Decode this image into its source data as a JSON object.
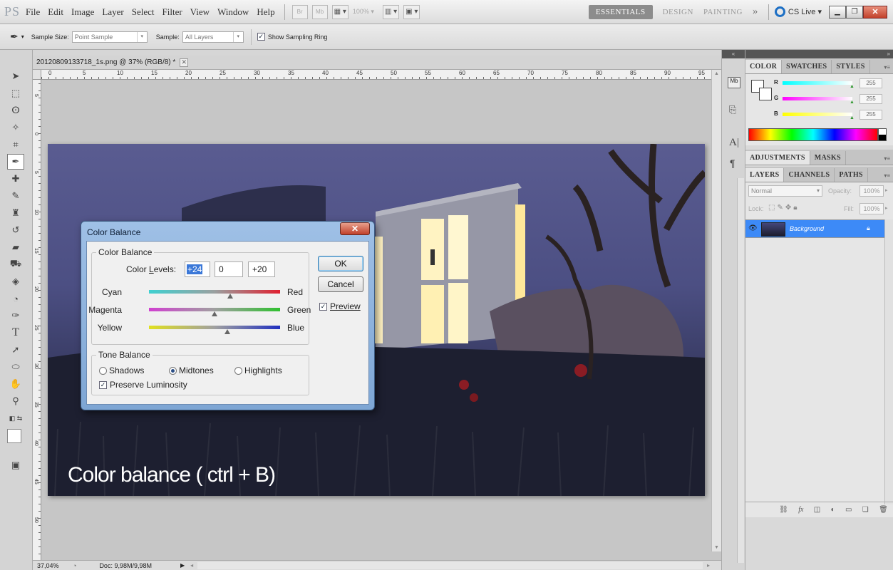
{
  "app": {
    "logo": "PS"
  },
  "menu": [
    "File",
    "Edit",
    "Image",
    "Layer",
    "Select",
    "Filter",
    "View",
    "Window",
    "Help"
  ],
  "topbar": {
    "br_label": "Br",
    "mb_label": "Mb",
    "zoom": "100%",
    "workspaces": [
      "ESSENTIALS",
      "DESIGN",
      "PAINTING"
    ],
    "more": "»",
    "cslive": "CS Live"
  },
  "options": {
    "sample_size_label": "Sample Size:",
    "sample_size_value": "Point Sample",
    "sample_label": "Sample:",
    "sample_value": "All Layers",
    "show_ring_label": "Show Sampling Ring"
  },
  "document": {
    "tab_title": "20120809133718_1s.png @ 37% (RGB/8) *",
    "ruler_top": [
      "0",
      "5",
      "10",
      "15",
      "20",
      "25",
      "30",
      "35",
      "40",
      "45",
      "50",
      "55",
      "60",
      "65",
      "70",
      "75",
      "80",
      "85",
      "90",
      "95"
    ],
    "ruler_left": [
      "5",
      "0",
      "5",
      "10",
      "15",
      "20",
      "25",
      "30",
      "35",
      "40",
      "45",
      "50"
    ],
    "caption": "Color balance ( ctrl + B)"
  },
  "status": {
    "zoom": "37,04%",
    "doc": "Doc: 9,98M/9,98M"
  },
  "color_panel": {
    "tabs": [
      "COLOR",
      "SWATCHES",
      "STYLES"
    ],
    "channels": [
      {
        "label": "R",
        "value": "255"
      },
      {
        "label": "G",
        "value": "255"
      },
      {
        "label": "B",
        "value": "255"
      }
    ]
  },
  "adjustments_panel": {
    "tabs": [
      "ADJUSTMENTS",
      "MASKS"
    ]
  },
  "layers_panel": {
    "tabs": [
      "LAYERS",
      "CHANNELS",
      "PATHS"
    ],
    "blend_mode": "Normal",
    "opacity_label": "Opacity:",
    "opacity_value": "100%",
    "lock_label": "Lock:",
    "fill_label": "Fill:",
    "fill_value": "100%",
    "layer_name": "Background"
  },
  "dialog": {
    "title": "Color Balance",
    "group_label": "Color Balance",
    "levels_label": "Color Levels:",
    "levels": [
      "+24",
      "0",
      "+20"
    ],
    "sliders": [
      {
        "left": "Cyan",
        "right": "Red",
        "value": 24
      },
      {
        "left": "Magenta",
        "right": "Green",
        "value": 0
      },
      {
        "left": "Yellow",
        "right": "Blue",
        "value": 20
      }
    ],
    "tone_label": "Tone Balance",
    "tone_options": [
      "Shadows",
      "Midtones",
      "Highlights"
    ],
    "tone_selected": "Midtones",
    "preserve_label": "Preserve Luminosity",
    "ok_label": "OK",
    "cancel_label": "Cancel",
    "preview_label": "Preview"
  }
}
